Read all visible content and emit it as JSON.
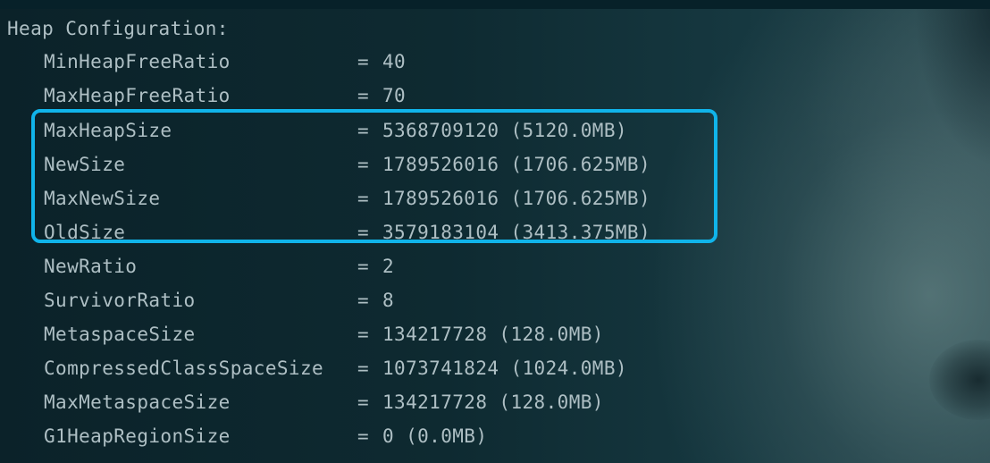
{
  "header": "Heap Configuration:",
  "rows": [
    {
      "key": "MinHeapFreeRatio",
      "value": "40"
    },
    {
      "key": "MaxHeapFreeRatio",
      "value": "70"
    },
    {
      "key": "MaxHeapSize",
      "value": "5368709120 (5120.0MB)"
    },
    {
      "key": "NewSize",
      "value": "1789526016 (1706.625MB)"
    },
    {
      "key": "MaxNewSize",
      "value": "1789526016 (1706.625MB)"
    },
    {
      "key": "OldSize",
      "value": "3579183104 (3413.375MB)"
    },
    {
      "key": "NewRatio",
      "value": "2"
    },
    {
      "key": "SurvivorRatio",
      "value": "8"
    },
    {
      "key": "MetaspaceSize",
      "value": "134217728 (128.0MB)"
    },
    {
      "key": "CompressedClassSpaceSize",
      "value": "1073741824 (1024.0MB)"
    },
    {
      "key": "MaxMetaspaceSize",
      "value": "134217728 (128.0MB)"
    },
    {
      "key": "G1HeapRegionSize",
      "value": "0 (0.0MB)"
    }
  ],
  "equals_sign": "=",
  "colors": {
    "background": "#0f2a31",
    "text": "#aebfc4",
    "highlight_border": "#10b4ea"
  }
}
